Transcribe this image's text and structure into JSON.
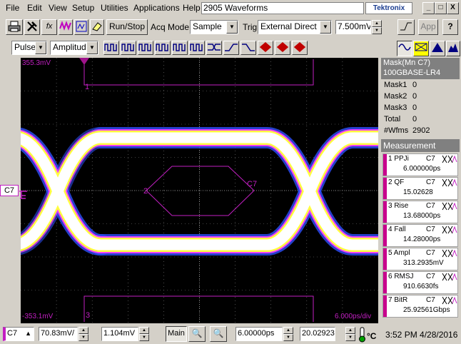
{
  "menubar": {
    "items": [
      "File",
      "Edit",
      "View",
      "Setup",
      "Utilities",
      "Applications",
      "Help"
    ],
    "title": "2905 Waveforms",
    "logo": "Tektronix",
    "window_buttons": [
      "_",
      "□",
      "X"
    ]
  },
  "toolbar1": {
    "run_stop": "Run/Stop",
    "acq_mode_label": "Acq Mode",
    "acq_mode_value": "Sample",
    "trig_label": "Trig",
    "trig_value": "External Direct",
    "trig_level": "7.500mV",
    "app_button": "App"
  },
  "toolbar2": {
    "pulse_value": "Pulse",
    "amplitude_value": "Amplitude"
  },
  "scope": {
    "top_level": "355.3mV",
    "bottom_level": "-353.1mV",
    "time_div": "6.000ps/div",
    "mask_labels": [
      "1",
      "2",
      "3"
    ],
    "channel_marker": "C7",
    "waveform_label": "C7"
  },
  "mask_panel": {
    "header_line1": "Mask(Mn C7)",
    "header_line2": "100GBASE-LR4",
    "rows": [
      {
        "label": "Mask1",
        "value": "0"
      },
      {
        "label": "Mask2",
        "value": "0"
      },
      {
        "label": "Mask3",
        "value": "0"
      },
      {
        "label": "Total",
        "value": "0"
      },
      {
        "label": "#Wfms",
        "value": "2902"
      }
    ],
    "measurement_header": "Measurement",
    "measurements": [
      {
        "name": "1 PPJi",
        "channel": "C7",
        "value": "6.000000ps"
      },
      {
        "name": "2 QF",
        "channel": "C7",
        "value": "15.02628"
      },
      {
        "name": "3 Rise",
        "channel": "C7",
        "value": "13.68000ps"
      },
      {
        "name": "4 Fall",
        "channel": "C7",
        "value": "14.28000ps"
      },
      {
        "name": "5 Ampl",
        "channel": "C7",
        "value": "313.2935mV"
      },
      {
        "name": "6 RMSJ",
        "channel": "C7",
        "value": "910.6630fs"
      },
      {
        "name": "7 BitR",
        "channel": "C7",
        "value": "25.92561Gbps"
      }
    ]
  },
  "bottom": {
    "channel": "C7",
    "volts_div": "70.83mV/",
    "offset": "1.104mV",
    "main_label": "Main",
    "time_scale": "6.00000ps",
    "position": "20.02923",
    "time": "3:52 PM 4/28/2016"
  },
  "colors": {
    "mask": "#c21fc2",
    "eye_core": "#ffffff",
    "eye_edge": "#ffff40",
    "grid": "#808080"
  }
}
